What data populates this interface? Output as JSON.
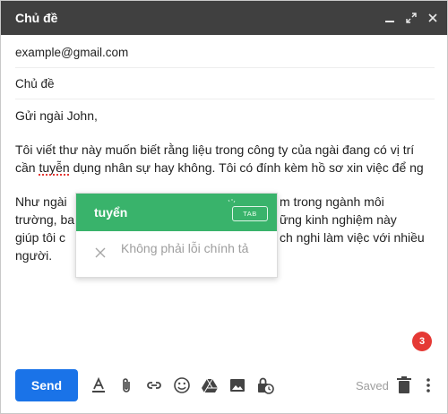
{
  "window": {
    "title": "Chủ đề",
    "controls": [
      "minimize-icon",
      "expand-icon",
      "close-icon"
    ]
  },
  "fields": {
    "to": "example@gmail.com",
    "subject": "Chủ đề"
  },
  "body": {
    "greeting": "Gửi ngài John,",
    "para1_pre": "Tôi viết thư này muốn biết rằng liệu trong công ty của ngài đang có vị trí cần ",
    "para1_misspelled": "tuyễn",
    "para1_post": " dụng nhân sự hay không. Tôi có đính kèm hồ sơ xin việc để ng",
    "para2_line1_left": "Như ngài",
    "para2_line1_right": "m trong ngành môi",
    "para2_line2_left": "trường, ba",
    "para2_line2_right": "ững kinh nghiệm này",
    "para2_line3_left": "giúp tôi c",
    "para2_line3_right": "ch nghi làm việc với nhiều",
    "para2_line4": "người."
  },
  "spellcheck_popup": {
    "suggestion": "tuyển",
    "shortcut_key": "TAB",
    "ignore_label": "Không phải lỗi chính tả"
  },
  "notification_badge": "3",
  "toolbar": {
    "send_label": "Send",
    "saved_label": "Saved",
    "icons": [
      "format-text-icon",
      "attach-icon",
      "link-icon",
      "emoji-icon",
      "drive-icon",
      "photo-icon",
      "confidential-mode-icon",
      "delete-icon",
      "more-options-icon"
    ]
  },
  "colors": {
    "titlebar": "#404040",
    "send_button": "#1a73e8",
    "suggestion_bg": "#39b36b",
    "badge": "#e53935"
  }
}
